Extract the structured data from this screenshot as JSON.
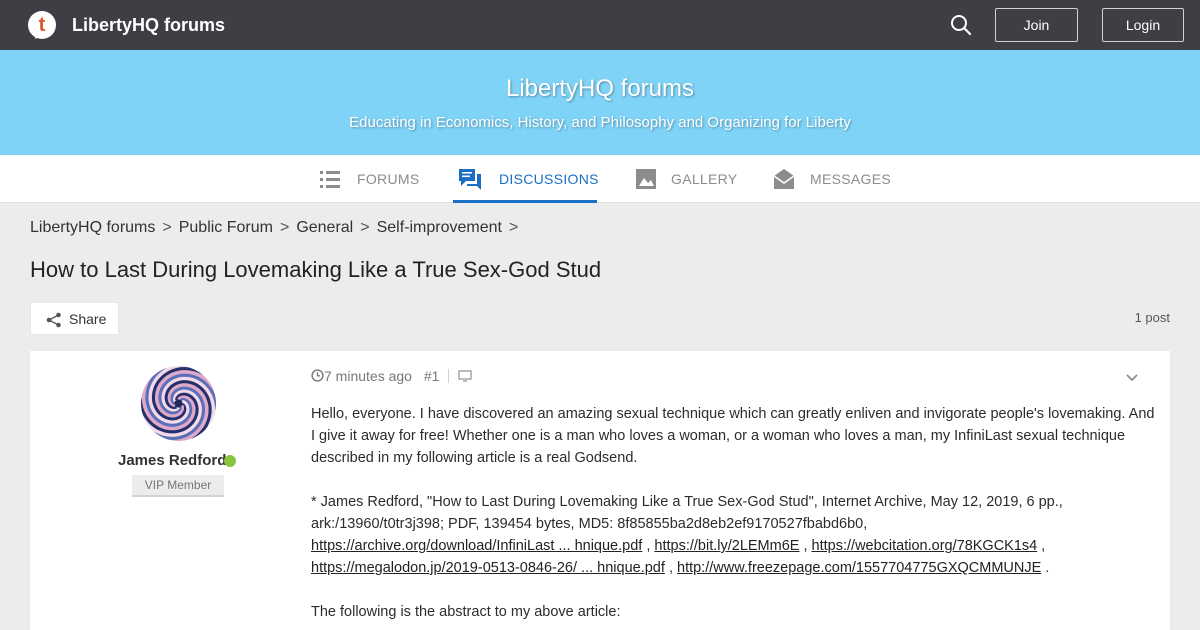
{
  "topbar": {
    "logo_letter": "t",
    "brand": "LibertyHQ forums",
    "join_label": "Join",
    "login_label": "Login"
  },
  "banner": {
    "title": "LibertyHQ forums",
    "subtitle": "Educating in Economics, History, and Philosophy and Organizing for Liberty"
  },
  "nav": {
    "items": [
      {
        "label": "FORUMS",
        "icon": "list-icon"
      },
      {
        "label": "DISCUSSIONS",
        "icon": "discussions-icon",
        "active": true
      },
      {
        "label": "GALLERY",
        "icon": "image-icon"
      },
      {
        "label": "MESSAGES",
        "icon": "envelope-icon"
      }
    ]
  },
  "breadcrumb": {
    "items": [
      "LibertyHQ forums",
      "Public Forum",
      "General",
      "Self-improvement"
    ],
    "separator": ">"
  },
  "page_title": "How to Last During Lovemaking Like a True Sex-God Stud",
  "share_label": "Share",
  "post_count": "1 post",
  "post": {
    "author": "James Redford",
    "role": "VIP Member",
    "time": "7 minutes ago",
    "number": "#1",
    "para1": "Hello, everyone. I have discovered an amazing sexual technique which can greatly enliven and invigorate people's lovemaking. And I give it away for free! Whether one is a man who loves a woman, or a woman who loves a man, my InfiniLast sexual technique described in my following article is a real Godsend.",
    "citation": "* James Redford, \"How to Last During Lovemaking Like a True Sex-God Stud\", Internet Archive, May 12, 2019, 6 pp., ark:/13960/t0tr3j398; PDF, 139454 bytes, MD5: 8f85855ba2d8eb2ef9170527fbabd6b0,",
    "links": [
      "https://archive.org/download/InfiniLast ... hnique.pdf",
      "https://bit.ly/2LEMm6E",
      "https://webcitation.org/78KGCK1s4",
      "https://megalodon.jp/2019-0513-0846-26/ ... hnique.pdf",
      "http://www.freezepage.com/1557704775GXQCMMUNJE"
    ],
    "link_sep": ",",
    "link_end": ".",
    "para3": "The following is the abstract to my above article:"
  },
  "colors": {
    "topbar": "#3e3e44",
    "banner": "#7fd3f7",
    "accent": "#1a6fc4",
    "online": "#8ac43f"
  }
}
